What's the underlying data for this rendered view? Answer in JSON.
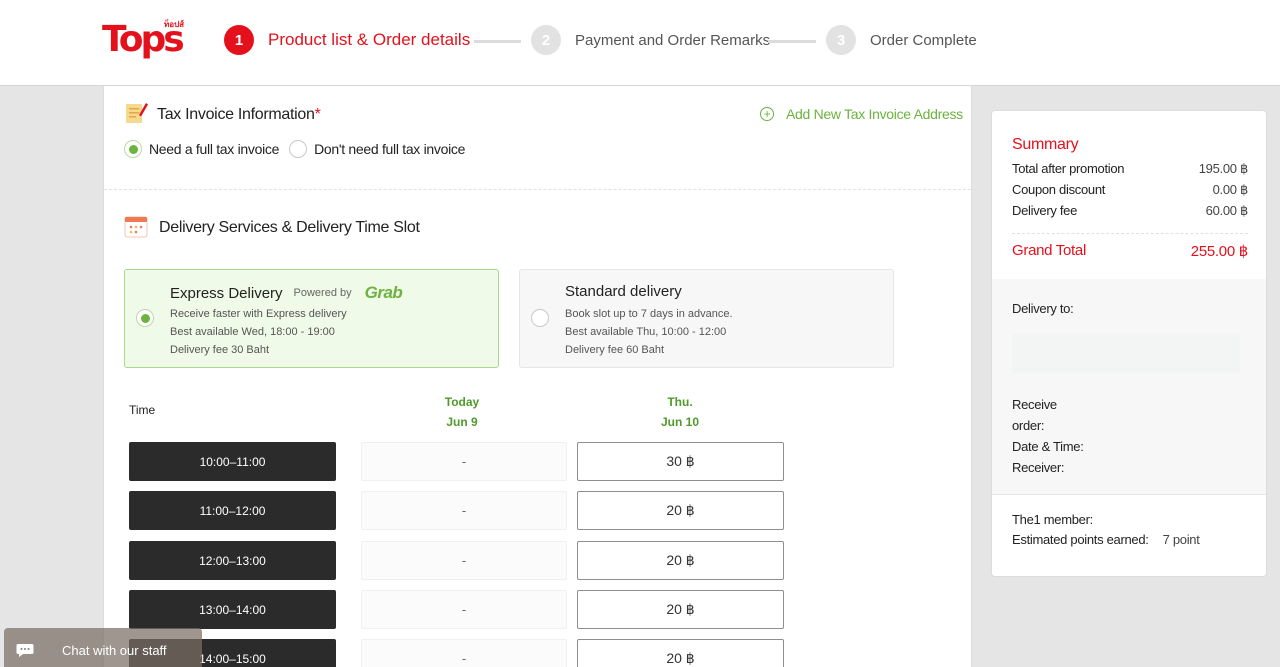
{
  "header": {
    "logo_text": "Tops",
    "logo_sub": "ท็อปส์",
    "steps": [
      {
        "num": "1",
        "label": "Product list & Order details"
      },
      {
        "num": "2",
        "label": "Payment and Order Remarks"
      },
      {
        "num": "3",
        "label": "Order Complete"
      }
    ]
  },
  "tax": {
    "title": "Tax Invoice Information",
    "required_mark": "*",
    "add_link": "Add New Tax Invoice Address",
    "option_full": "Need a full tax invoice",
    "option_none": "Don't need full tax invoice",
    "selected": "full"
  },
  "delivery": {
    "title": "Delivery Services & Delivery Time Slot",
    "express": {
      "title": "Express Delivery",
      "powered_by": "Powered by",
      "partner": "Grab",
      "line1": "Receive faster with Express delivery",
      "line2": "Best available Wed, 18:00 - 19:00",
      "line3": "Delivery fee 30 Baht"
    },
    "standard": {
      "title": "Standard delivery",
      "line1": "Book slot up to 7 days in advance.",
      "line2": "Best available Thu, 10:00 - 12:00",
      "line3": "Delivery fee 60 Baht"
    }
  },
  "slots": {
    "time_header": "Time",
    "days": [
      {
        "day": "Today",
        "date": "Jun 9"
      },
      {
        "day": "Thu.",
        "date": "Jun 10"
      }
    ],
    "rows": [
      {
        "time": "10:00–11:00",
        "today": "-",
        "thu": "30 ฿"
      },
      {
        "time": "11:00–12:00",
        "today": "-",
        "thu": "20 ฿"
      },
      {
        "time": "12:00–13:00",
        "today": "-",
        "thu": "20 ฿"
      },
      {
        "time": "13:00–14:00",
        "today": "-",
        "thu": "20 ฿"
      },
      {
        "time": "14:00–15:00",
        "today": "-",
        "thu": "20 ฿"
      }
    ]
  },
  "summary": {
    "title": "Summary",
    "after_promo_label": "Total after promotion",
    "after_promo_value": "195.00 ฿",
    "coupon_label": "Coupon discount",
    "coupon_value": "0.00 ฿",
    "delivery_fee_label": "Delivery fee",
    "delivery_fee_value": "60.00 ฿",
    "grand_label": "Grand Total",
    "grand_value": "255.00 ฿",
    "delivery_to_label": "Delivery to:",
    "receive_label": "Receive",
    "order_label": "order:",
    "datetime_label": "Date & Time:",
    "receiver_label": "Receiver:",
    "member_label": "The1 member:",
    "points_label": "Estimated points earned:",
    "points_value": "7 point"
  },
  "chat": {
    "label": "Chat with our staff"
  },
  "colors": {
    "brand": "#e4111d",
    "accent": "#6cb33f"
  }
}
